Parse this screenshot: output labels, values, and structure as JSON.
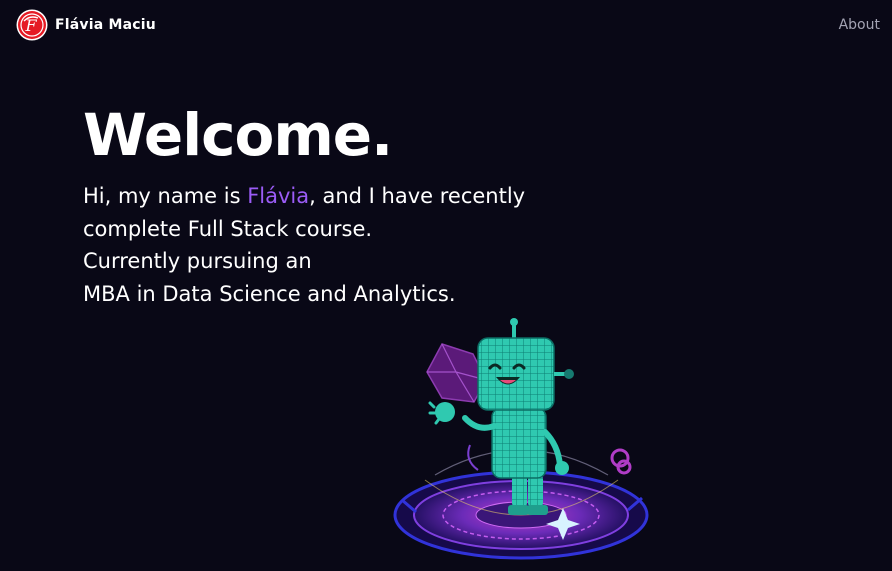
{
  "navbar": {
    "brand": {
      "logo_letter": "F",
      "name": "Flávia Maciu"
    },
    "links": [
      {
        "label": "About"
      }
    ]
  },
  "hero": {
    "title": "Welcome.",
    "intro_before": "Hi, my name is ",
    "intro_name": "Flávia",
    "intro_after": ", and I have recently",
    "line2": "complete Full Stack course.",
    "line3": "Currently pursuing an",
    "line4": "MBA in Data Science and Analytics."
  },
  "colors": {
    "background": "#090816",
    "accent": "#9b5cf6",
    "logo_red": "#e51b24",
    "robot_teal": "#2fc9b0",
    "platform_purple": "#6b2bb8"
  },
  "illustration": {
    "icon": "robot-illustration"
  }
}
